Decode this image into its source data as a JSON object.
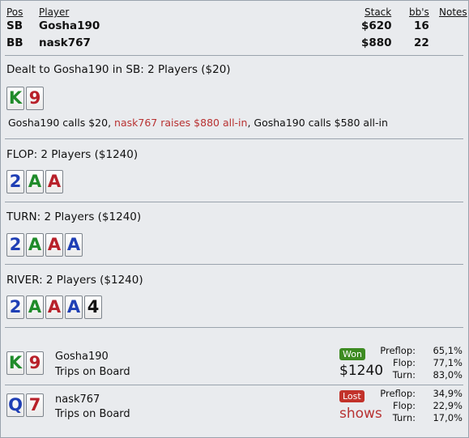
{
  "header": {
    "col_pos": "Pos",
    "col_player": "Player",
    "col_stack": "Stack",
    "col_bbs": "bb's",
    "col_notes": "Notes",
    "rows": [
      {
        "pos": "SB",
        "player": "Gosha190",
        "stack": "$620",
        "bbs": "16"
      },
      {
        "pos": "BB",
        "player": "nask767",
        "stack": "$880",
        "bbs": "22"
      }
    ]
  },
  "preflop": {
    "title": "Dealt to Gosha190 in SB: 2 Players ($20)",
    "cards": [
      {
        "rank": "K",
        "suit": "c"
      },
      {
        "rank": "9",
        "suit": "h"
      }
    ],
    "action_1": "Gosha190 calls $20, ",
    "action_2": "nask767 raises $880 all-in",
    "action_3": ", Gosha190 calls $580 all-in"
  },
  "flop": {
    "title": "FLOP: 2 Players ($1240)",
    "cards": [
      {
        "rank": "2",
        "suit": "d"
      },
      {
        "rank": "A",
        "suit": "c"
      },
      {
        "rank": "A",
        "suit": "h"
      }
    ]
  },
  "turn": {
    "title": "TURN: 2 Players ($1240)",
    "cards": [
      {
        "rank": "2",
        "suit": "d"
      },
      {
        "rank": "A",
        "suit": "c"
      },
      {
        "rank": "A",
        "suit": "h"
      },
      {
        "rank": "A",
        "suit": "d"
      }
    ]
  },
  "river": {
    "title": "RIVER: 2 Players ($1240)",
    "cards": [
      {
        "rank": "2",
        "suit": "d"
      },
      {
        "rank": "A",
        "suit": "c"
      },
      {
        "rank": "A",
        "suit": "h"
      },
      {
        "rank": "A",
        "suit": "d"
      },
      {
        "rank": "4",
        "suit": "s"
      }
    ]
  },
  "results": [
    {
      "player": "Gosha190",
      "hand": "Trips on Board",
      "badge": "Won",
      "amount": "$1240",
      "cards": [
        {
          "rank": "K",
          "suit": "c"
        },
        {
          "rank": "9",
          "suit": "h"
        }
      ],
      "equity": [
        {
          "label": "Preflop:",
          "value": "65,1%"
        },
        {
          "label": "Flop:",
          "value": "77,1%"
        },
        {
          "label": "Turn:",
          "value": "83,0%"
        }
      ]
    },
    {
      "player": "nask767",
      "hand": "Trips on Board",
      "badge": "Lost",
      "amount": "shows",
      "cards": [
        {
          "rank": "Q",
          "suit": "d"
        },
        {
          "rank": "7",
          "suit": "h"
        }
      ],
      "equity": [
        {
          "label": "Preflop:",
          "value": "34,9%"
        },
        {
          "label": "Flop:",
          "value": "22,9%"
        },
        {
          "label": "Turn:",
          "value": "17,0%"
        }
      ]
    }
  ],
  "colors": {
    "spades": "#111111",
    "hearts": "#b8212a",
    "diamonds": "#1f3fb5",
    "clubs": "#1f8b2a",
    "won": "#3d8b22",
    "lost": "#c2322a"
  }
}
